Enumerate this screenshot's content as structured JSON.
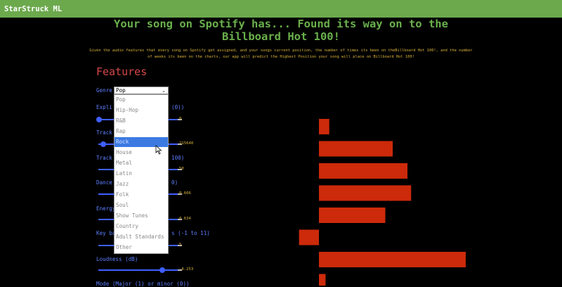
{
  "navbar": {
    "brand": "StarStruck ML"
  },
  "header": {
    "title": "Your song on Spotify has... Found its way on to the Billboard Hot 100!",
    "description": "Given the audio features that every song on Spotify get assigned, and your songs current position, the number of times its been on theBillboard Hot 100!, and the number of weeks its been on the charts, our app will predict the Highest Position your song will place on Billboard Hot 100!"
  },
  "features": {
    "heading": "Features",
    "genre_label": "Genre",
    "genre_selected": "Pop",
    "genre_options": [
      "Pop",
      "Hip-Hop",
      "R&B",
      "Rap",
      "Rock",
      "House",
      "Metal",
      "Latin",
      "Jazz",
      "Folk",
      "Soul",
      "Show Tunes",
      "Country",
      "Adult Standards",
      "Other"
    ],
    "highlighted_option": "Rock",
    "labels": {
      "explicit": "Expli",
      "explicit_tail": "(0))",
      "track1": "Track",
      "track2": "Track",
      "track2_tail": "100)",
      "dance": "Dance",
      "dance_tail": "0)",
      "energy": "Energy",
      "key": "Key ba",
      "key_tail": "s (-1 to 11)",
      "loudness": "Loudness (dB)",
      "mode": "Mode (Major (1) or minor (0))"
    },
    "sliders": [
      {
        "id": "explicit",
        "value": "0",
        "level": 0.0
      },
      {
        "id": "track-duration",
        "value": "215640",
        "level": 0.1
      },
      {
        "id": "track-popularity",
        "value": "50",
        "level": 0.5
      },
      {
        "id": "danceability",
        "value": "0.606",
        "level": 0.606
      },
      {
        "id": "energy",
        "value": "0.634",
        "level": 0.634
      },
      {
        "id": "key",
        "value": "5",
        "level": 0.5
      },
      {
        "id": "loudness",
        "value": "-8.253",
        "level": 0.8
      }
    ]
  },
  "colors": {
    "navbar": "#6ca94d",
    "title": "#6ab04c",
    "description": "#d9b23a",
    "heading": "#d7484a",
    "label": "#5d7fff",
    "slider": "#3f5fff",
    "bar": "#cc2a0a",
    "highlight": "#3c7ae2"
  },
  "chart_data": {
    "type": "bar",
    "orientation": "horizontal",
    "values": [
      0.14,
      1.0,
      1.2,
      1.25,
      0.9,
      -0.27,
      1.99,
      0.09
    ],
    "xlim": [
      -0.27,
      1.99
    ]
  }
}
